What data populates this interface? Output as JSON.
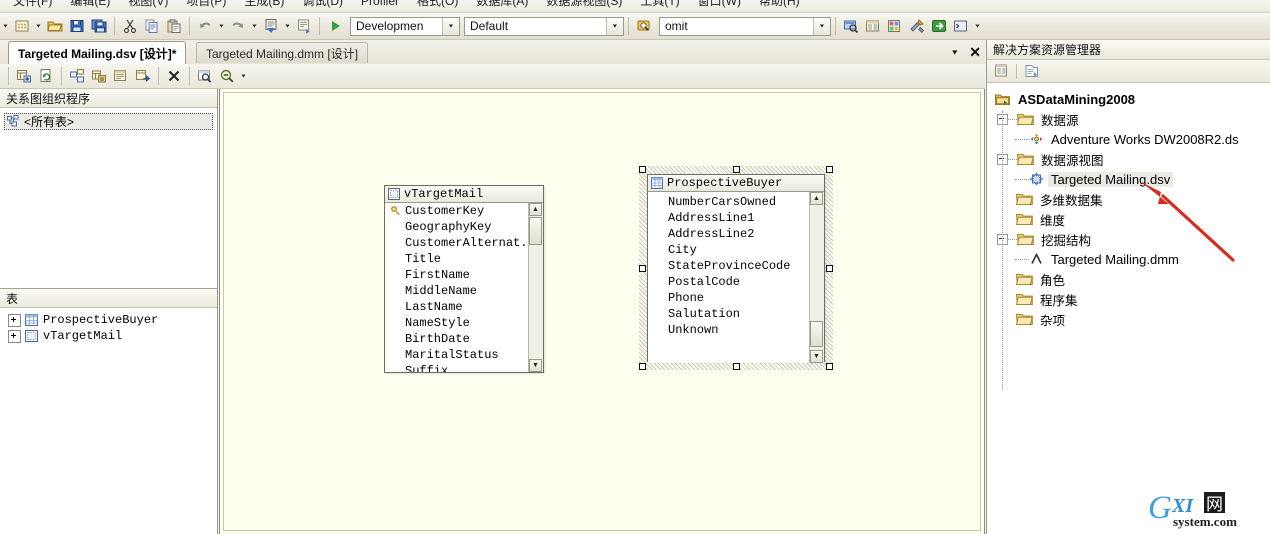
{
  "menubar": {
    "items": [
      {
        "label": "文件(F)"
      },
      {
        "label": "编辑(E)"
      },
      {
        "label": "视图(V)"
      },
      {
        "label": "项目(P)"
      },
      {
        "label": "生成(B)"
      },
      {
        "label": "调试(D)"
      },
      {
        "label": "Profiler"
      },
      {
        "label": "格式(O)"
      },
      {
        "label": "数据库(A)"
      },
      {
        "label": "数据源视图(S)"
      },
      {
        "label": "工具(T)"
      },
      {
        "label": "窗口(W)"
      },
      {
        "label": "帮助(H)"
      }
    ]
  },
  "toolbar": {
    "config_combo": {
      "value": "Developmen",
      "name": "solution-configuration"
    },
    "platform_combo": {
      "value": "Default",
      "name": "solution-platform"
    },
    "omit_combo": {
      "value": "omit",
      "name": "omit-combo"
    },
    "icons": [
      "new-project-icon",
      "open-file-icon",
      "save-icon",
      "save-all-icon",
      "cut-icon",
      "copy-icon",
      "paste-icon",
      "undo-icon",
      "redo-icon",
      "navigate-icon",
      "comment-icon",
      "start-debug-icon",
      "object-explorer-icon",
      "properties-window-icon",
      "template-explorer-icon",
      "tools-icon",
      "go-icon",
      "console-icon"
    ]
  },
  "tabs": {
    "active": {
      "label": "Targeted Mailing.dsv [设计]*"
    },
    "inactive": {
      "label": "Targeted Mailing.dmm [设计]"
    },
    "dropdown_icon": "chevron-down-icon",
    "close_icon": "close-icon"
  },
  "designer_toolbar": {
    "icons": [
      "add-table-icon",
      "refresh-icon",
      "new-named-query-icon",
      "new-named-calculation-icon",
      "replace-table-icon",
      "explore-data-icon",
      "delete-icon",
      "find-table-icon",
      "zoom-out-icon",
      "zoom-dropdown-icon"
    ]
  },
  "left_panel": {
    "diagram_organizer": {
      "header": "关系图组织程序",
      "selected_item": "<所有表>",
      "item_icon": "diagram-icon"
    },
    "tables": {
      "header": "表",
      "items": [
        {
          "label": "ProspectiveBuyer",
          "icon": "table-icon"
        },
        {
          "label": "vTargetMail",
          "icon": "view-icon"
        }
      ]
    }
  },
  "canvas": {
    "background_color": "#fffff0",
    "tables": [
      {
        "name": "vTargetMail",
        "icon": "view-icon",
        "selected": false,
        "fields": [
          {
            "label": "CustomerKey",
            "key": true
          },
          {
            "label": "GeographyKey",
            "key": false
          },
          {
            "label": "CustomerAlternat...",
            "key": false
          },
          {
            "label": "Title",
            "key": false
          },
          {
            "label": "FirstName",
            "key": false
          },
          {
            "label": "MiddleName",
            "key": false
          },
          {
            "label": "LastName",
            "key": false
          },
          {
            "label": "NameStyle",
            "key": false
          },
          {
            "label": "BirthDate",
            "key": false
          },
          {
            "label": "MaritalStatus",
            "key": false
          },
          {
            "label": "Suffix",
            "key": false
          }
        ]
      },
      {
        "name": "ProspectiveBuyer",
        "icon": "table-icon",
        "selected": true,
        "fields": [
          {
            "label": "NumberCarsOwned",
            "key": false
          },
          {
            "label": "AddressLine1",
            "key": false
          },
          {
            "label": "AddressLine2",
            "key": false
          },
          {
            "label": "City",
            "key": false
          },
          {
            "label": "StateProvinceCode",
            "key": false
          },
          {
            "label": "PostalCode",
            "key": false
          },
          {
            "label": "Phone",
            "key": false
          },
          {
            "label": "Salutation",
            "key": false
          },
          {
            "label": "Unknown",
            "key": false
          }
        ]
      }
    ]
  },
  "solution_explorer": {
    "header": "解决方案资源管理器",
    "toolbar_icons": [
      "properties-icon",
      "show-all-files-icon"
    ],
    "root": {
      "label": "ASDataMining2008",
      "icon": "project-icon"
    },
    "nodes": [
      {
        "label": "数据源",
        "icon": "folder-icon",
        "level": 1,
        "expandable": true,
        "children": [
          {
            "label": "Adventure Works DW2008R2.ds",
            "icon": "datasource-icon",
            "level": 2
          }
        ]
      },
      {
        "label": "数据源视图",
        "icon": "folder-icon",
        "level": 1,
        "expandable": true,
        "children": [
          {
            "label": "Targeted Mailing.dsv",
            "icon": "dsv-icon",
            "level": 2,
            "selected": true
          }
        ]
      },
      {
        "label": "多维数据集",
        "icon": "folder-icon",
        "level": 1,
        "expandable": false
      },
      {
        "label": "维度",
        "icon": "folder-icon",
        "level": 1,
        "expandable": false
      },
      {
        "label": "挖掘结构",
        "icon": "folder-icon",
        "level": 1,
        "expandable": true,
        "children": [
          {
            "label": "Targeted Mailing.dmm",
            "icon": "mining-model-icon",
            "level": 2
          }
        ]
      },
      {
        "label": "角色",
        "icon": "folder-icon",
        "level": 1,
        "expandable": false
      },
      {
        "label": "程序集",
        "icon": "folder-icon",
        "level": 1,
        "expandable": false
      },
      {
        "label": "杂项",
        "icon": "folder-icon",
        "level": 1,
        "expandable": false
      }
    ]
  },
  "annotation": {
    "arrow_color": "#d92b1c",
    "name": "red-pointer-arrow"
  },
  "watermark": {
    "main": "GXI",
    "cjk": "网",
    "sub": "system.com",
    "color": "#2a8fd4"
  }
}
